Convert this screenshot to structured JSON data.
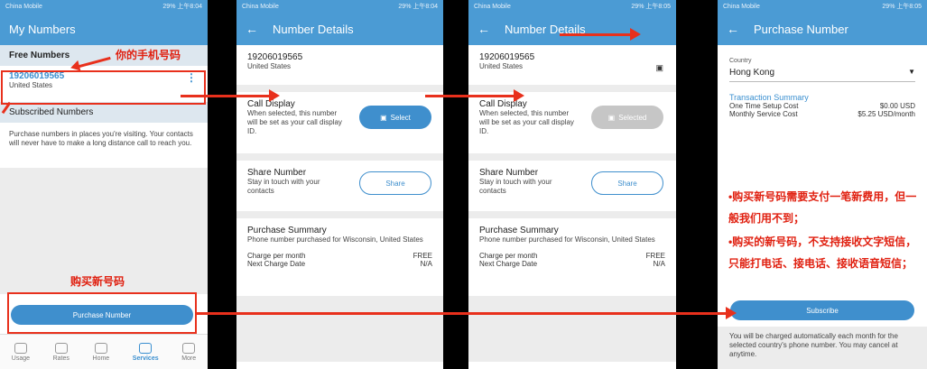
{
  "status": {
    "carrier": "China Mobile",
    "battery1": "29%",
    "time1": "上午8:04",
    "battery2": "29%",
    "time2": "上午8:05"
  },
  "s1": {
    "title": "My Numbers",
    "free_header": "Free Numbers",
    "number": "19206019565",
    "country": "United States",
    "subscribed_header": "Subscribed Numbers",
    "subscribed_body": "Purchase numbers in places you're visiting. Your contacts will never have to make a long distance call to reach you.",
    "purchase_btn": "Purchase Number",
    "tabs": [
      "Usage",
      "Rates",
      "Home",
      "Services",
      "More"
    ]
  },
  "s2": {
    "title": "Number Details",
    "number": "19206019565",
    "country": "United States",
    "call_display_title": "Call Display",
    "call_display_body": "When selected, this number will be set as your call display ID.",
    "select_btn": "Select",
    "share_title": "Share Number",
    "share_body": "Stay in touch with your contacts",
    "share_btn": "Share",
    "purchase_summary_title": "Purchase Summary",
    "purchase_summary_body": "Phone number purchased for Wisconsin, United States",
    "charge_label": "Charge per month",
    "charge_value": "FREE",
    "next_label": "Next Charge Date",
    "next_value": "N/A"
  },
  "s3": {
    "selected_btn": "Selected"
  },
  "s4": {
    "title": "Purchase Number",
    "country_label": "Country",
    "country_value": "Hong Kong",
    "summary_title": "Transaction Summary",
    "setup_label": "One Time Setup Cost",
    "setup_value": "$0.00 USD",
    "monthly_label": "Monthly Service Cost",
    "monthly_value": "$5.25 USD/month",
    "subscribe_btn": "Subscribe",
    "footer": "You will be charged automatically each month for the selected country's phone number. You may cancel at anytime."
  },
  "annotations": {
    "your_number": "你的手机号码",
    "buy_new": "购买新号码",
    "note1": "•购买新号码需要支付一笔新费用，但一般我们用不到；",
    "note2": "•购买的新号码，不支持接收文字短信，只能打电话、接电话、接收语音短信；"
  },
  "colors": {
    "brand": "#4b9bd4",
    "accent_red": "#e02010"
  }
}
